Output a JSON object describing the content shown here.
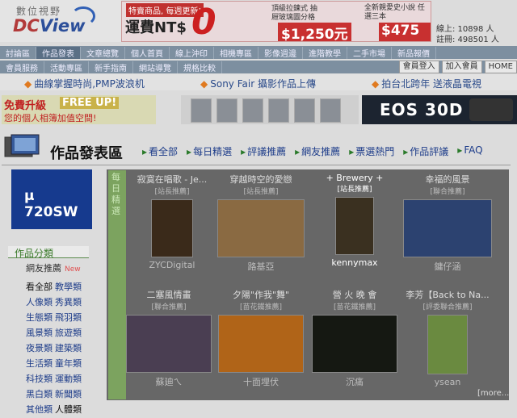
{
  "brand": {
    "chinese": "數位視野",
    "latin_a": "DC",
    "latin_b": "View"
  },
  "ad_top": {
    "tag": "特賣商品, 每週更新!",
    "shipping": "運費NT$",
    "zero": "0",
    "item1": "頂級拉鍊式 抽屜玻璃圖分格",
    "price1": "$1,250元",
    "item2": "全新親愛史小說 任選三本",
    "price2": "$475元"
  },
  "stats": {
    "online": "線上: 10898 人",
    "registered": "註冊: 498501 人"
  },
  "nav1": [
    "討論區",
    "作品發表",
    "文章總覽",
    "個人首頁",
    "線上沖印",
    "相機專區",
    "影像週邊",
    "進階教學",
    "二手市場",
    "新品報價"
  ],
  "nav2": [
    "會員服務",
    "活動專區",
    "新手指南",
    "網站導覽",
    "規格比較"
  ],
  "nav2_side": [
    "會員登入",
    "加入會員",
    "HOME"
  ],
  "news": [
    "曲線掌握時尚,PMP波浪机",
    "Sony Fair 攝影作品上傳",
    "拍台北跨年 送液晶電視"
  ],
  "ad_free": {
    "t1": "免費升級",
    "t2": "FREE UP!",
    "t3": "您的個人相簿加值空間!"
  },
  "ad_camera": {
    "text": "EOS 30D"
  },
  "section": {
    "title": "作品發表區"
  },
  "tabs": [
    "看全部",
    "每日精選",
    "評議推薦",
    "網友推薦",
    "票選熱門",
    "作品評議",
    "FAQ"
  ],
  "sidebar": {
    "ad_text": "μ 720SW",
    "category_title": "作品分類",
    "friend": "網友推薦",
    "friend_badge": "New",
    "categories": [
      [
        "看全部",
        "教學類"
      ],
      [
        "人像類",
        "秀異類"
      ],
      [
        "生態類",
        "飛羽類"
      ],
      [
        "風景類",
        "旅遊類"
      ],
      [
        "夜景類",
        "建築類"
      ],
      [
        "生活類",
        "童年類"
      ],
      [
        "科技類",
        "運動類"
      ],
      [
        "黑白類",
        "新聞類"
      ],
      [
        "其他類",
        "人體類"
      ]
    ]
  },
  "panel": {
    "label": "每日精選",
    "more": "[more...]"
  },
  "works": [
    {
      "title": "寂寞在唱歌 - Je...",
      "sub": "[站長推薦]",
      "author": "ZYCDigital",
      "img_bg": "#3a2a1a"
    },
    {
      "title": "穿越時空的愛戀",
      "sub": "[站長推薦]",
      "author": "路基亞",
      "img_bg": "#8a6a42"
    },
    {
      "title": "+ Brewery +",
      "sub": "[站長推薦]",
      "author": "kennymax",
      "img_bg": "#3a3020"
    },
    {
      "title": "幸福的風景",
      "sub": "[聯合推薦]",
      "author": "鏞仔涵",
      "img_bg": "#2c4270"
    },
    {
      "title": "二塞風情畫",
      "sub": "[聯合推薦]",
      "author": "蘇廸ㄟ",
      "img_bg": "#4a3e52"
    },
    {
      "title": "夕陽\"作我\"舞\"",
      "sub": "[苗花鐵推薦]",
      "author": "十面埋伏",
      "img_bg": "#b06418"
    },
    {
      "title": "營 火 晚 會",
      "sub": "[苗花鐵推薦]",
      "author": "沉痛",
      "img_bg": "#151812"
    },
    {
      "title": "李芳【Back to Na...",
      "sub": "[評委聯合推薦]",
      "author": "ysean",
      "img_bg": "#6a8a40"
    }
  ]
}
